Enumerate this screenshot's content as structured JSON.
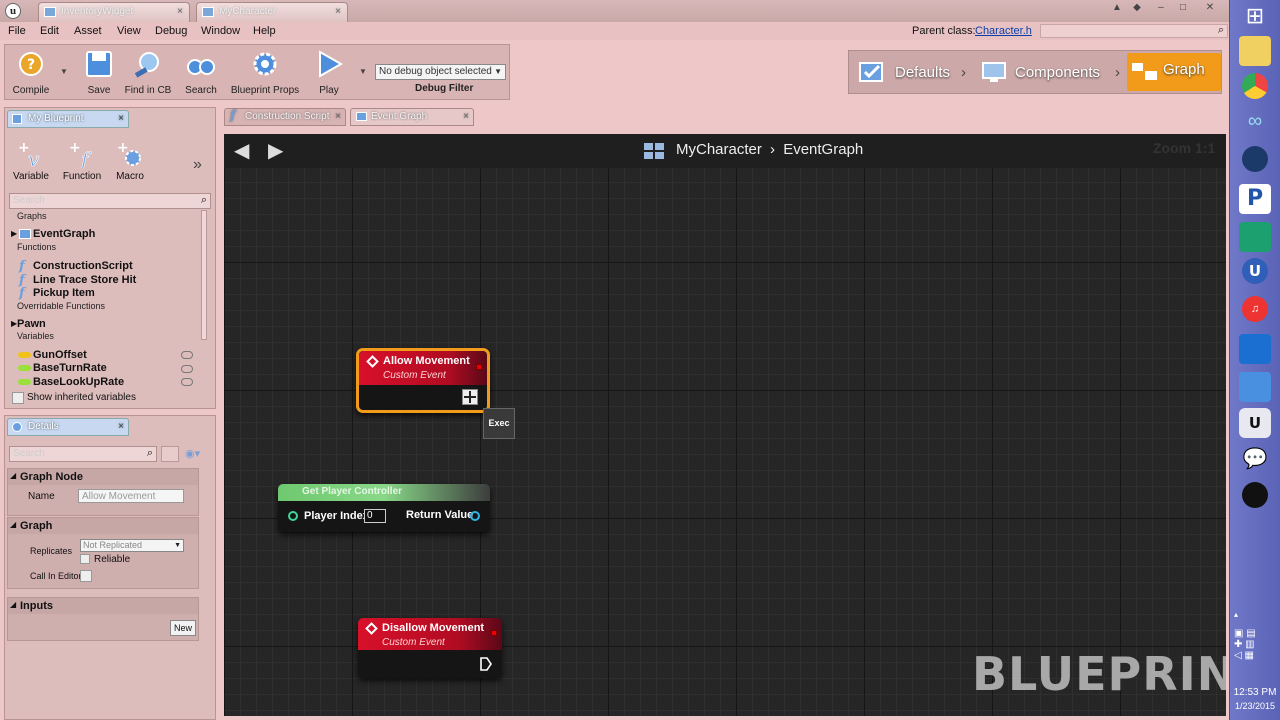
{
  "window": {
    "tabs": [
      {
        "label": "InventoryWidget"
      },
      {
        "label": "MyCharacter"
      }
    ],
    "parent_class_label": "Parent class:",
    "parent_class_value": "Character.h"
  },
  "menu": [
    "File",
    "Edit",
    "Asset",
    "View",
    "Debug",
    "Window",
    "Help"
  ],
  "toolbar": {
    "compile": "Compile",
    "save": "Save",
    "find_in_cb": "Find in CB",
    "search": "Search",
    "blueprint_props": "Blueprint Props",
    "play": "Play",
    "debug_select": "No debug object selected",
    "debug_filter": "Debug Filter"
  },
  "modes": {
    "defaults": "Defaults",
    "components": "Components",
    "graph": "Graph"
  },
  "my_blueprint": {
    "tab": "My Blueprint",
    "add_variable": "Variable",
    "add_function": "Function",
    "add_macro": "Macro",
    "search_placeholder": "Search",
    "sections": {
      "graphs": "Graphs",
      "functions": "Functions",
      "overridable": "Overridable Functions",
      "variables": "Variables"
    },
    "graphs": [
      "EventGraph"
    ],
    "functions": [
      "ConstructionScript",
      "Line Trace Store Hit",
      "Pickup Item"
    ],
    "overridable": [
      "Pawn"
    ],
    "variables": [
      {
        "name": "GunOffset",
        "color": "#f2c21b"
      },
      {
        "name": "BaseTurnRate",
        "color": "#9be03a"
      },
      {
        "name": "BaseLookUpRate",
        "color": "#9be03a"
      }
    ],
    "show_inherited": "Show inherited variables"
  },
  "details": {
    "tab": "Details",
    "search_placeholder": "Search",
    "graph_node_header": "Graph Node",
    "name_label": "Name",
    "name_value": "Allow Movement",
    "graph_header": "Graph",
    "replicates_label": "Replicates",
    "replicates_value": "Not Replicated",
    "reliable_label": "Reliable",
    "call_in_editor_label": "Call In Editor",
    "inputs_header": "Inputs",
    "new_button": "New"
  },
  "editor_tabs": [
    {
      "label": "Construction Script"
    },
    {
      "label": "Event Graph"
    }
  ],
  "graph": {
    "breadcrumb_root": "MyCharacter",
    "breadcrumb_leaf": "EventGraph",
    "zoom": "Zoom 1:1",
    "watermark": "BLUEPRINT",
    "tooltip": "Exec",
    "nodes": {
      "allow": {
        "title": "Allow Movement",
        "subtitle": "Custom Event"
      },
      "getpc": {
        "title": "Get Player Controller",
        "input_label": "Player Index",
        "input_value": "0",
        "output_label": "Return Value"
      },
      "disallow": {
        "title": "Disallow Movement",
        "subtitle": "Custom Event"
      }
    }
  },
  "taskbar": {
    "time": "12:53 PM",
    "date": "1/23/2015"
  }
}
